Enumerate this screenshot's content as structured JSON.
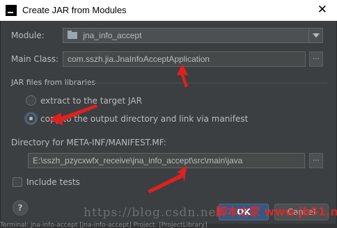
{
  "window": {
    "title": "Create JAR from Modules",
    "close_glyph": "✕"
  },
  "module": {
    "label": "Module:",
    "value": "jna_info_accept"
  },
  "main_class": {
    "label": "Main Class:",
    "value": "com.sszh.jia.JnaInfoAcceptApplication",
    "browse": "..."
  },
  "jar_files": {
    "section_title": "JAR files from libraries",
    "options": [
      {
        "label": "extract to the target JAR",
        "selected": false
      },
      {
        "label": "copy to the output directory and link via manifest",
        "selected": true
      }
    ]
  },
  "manifest": {
    "label": "Directory for META-INF/MANIFEST.MF:",
    "value": "E:\\sszh_pzycxwfx_receive\\jna_info_accept\\src\\main\\java",
    "browse": "..."
  },
  "include_tests": {
    "label": "Include tests",
    "checked": false
  },
  "help": {
    "glyph": "?"
  },
  "buttons": {
    "ok": "OK",
    "cancel": "Cancel"
  },
  "status_bar": {
    "text": "Terminal: jna-info-accept  [jna-info-accept] Project: [ProjectLibrary]"
  },
  "watermark": {
    "text": "https://blog.csdn.net/"
  },
  "brand": {
    "text": "脚本之家 www.jb51.net"
  },
  "annotation_color": "#e02020"
}
